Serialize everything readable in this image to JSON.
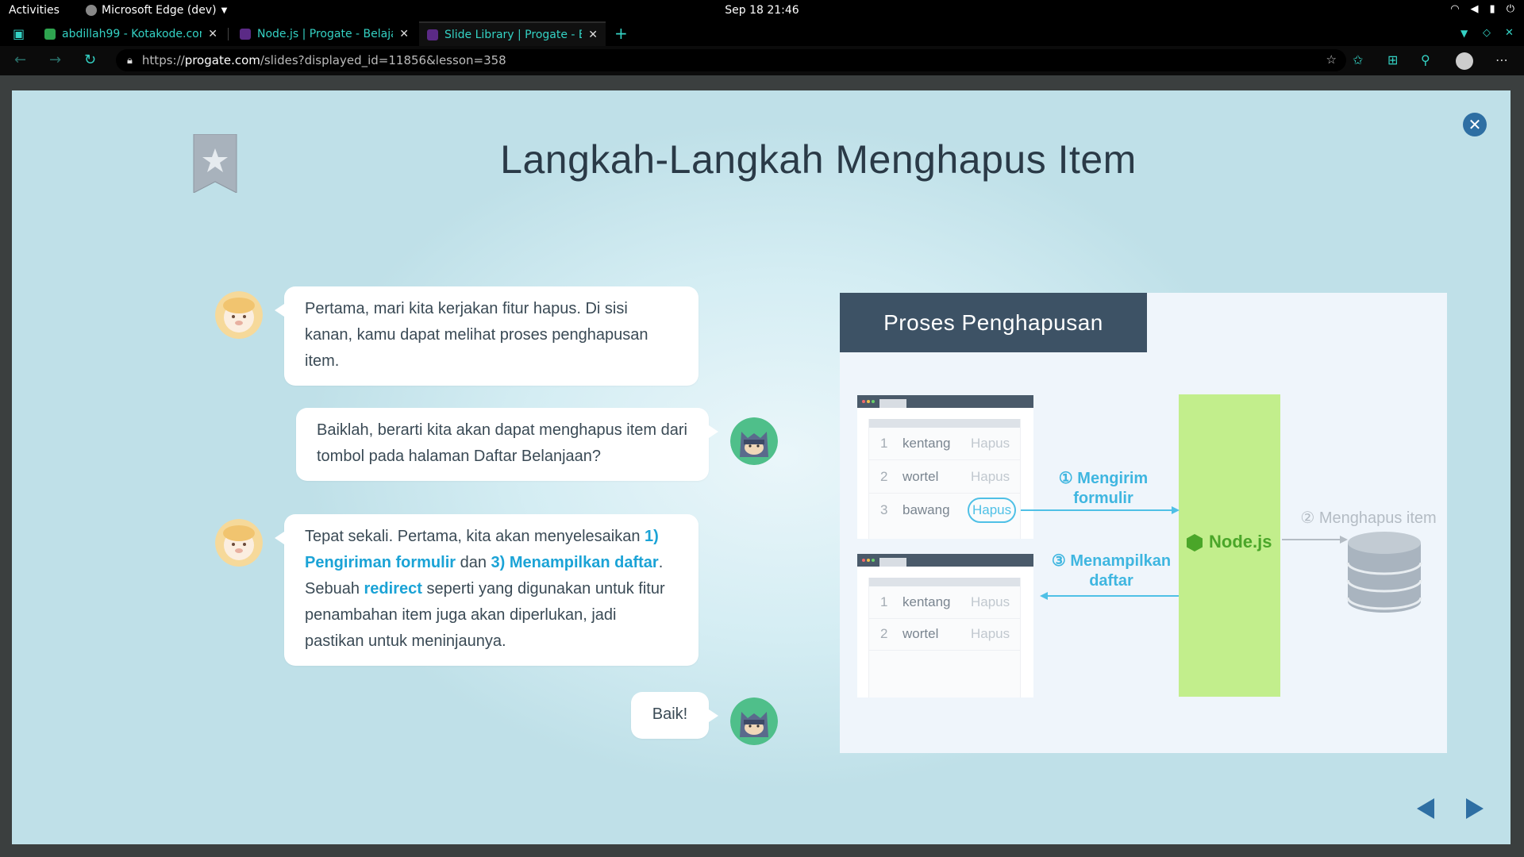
{
  "system": {
    "activities": "Activities",
    "app_name": "Microsoft Edge (dev)",
    "clock": "Sep 18  21:46"
  },
  "tabs": [
    {
      "title": "abdillah99 - Kotakode.com",
      "favicon_color": "#2ea44f"
    },
    {
      "title": "Node.js | Progate - Belajar",
      "favicon_color": "#5b2a86"
    },
    {
      "title": "Slide Library | Progate - Belajar",
      "favicon_color": "#5b2a86",
      "active": true
    }
  ],
  "address_bar": {
    "url_prefix": "https://",
    "url_domain": "progate.com",
    "url_path": "/slides?displayed_id=11856&lesson=358"
  },
  "slide": {
    "title": "Langkah-Langkah Menghapus Item",
    "messages": [
      {
        "speaker": "sheep",
        "text": "Pertama, mari kita kerjakan fitur hapus. Di sisi kanan, kamu dapat melihat proses penghapusan item."
      },
      {
        "speaker": "ninja",
        "text": "Baiklah, berarti kita akan dapat menghapus item dari tombol pada halaman Daftar Belanjaan?"
      },
      {
        "speaker": "sheep",
        "part1": "Tepat sekali. Pertama, kita akan menyelesaikan ",
        "hl1": "1) Pengiriman formulir",
        "part2": " dan ",
        "hl2": "3) Menampilkan daftar",
        "part3": ". Sebuah ",
        "hl3": "redirect",
        "part4": " seperti yang digunakan untuk fitur penambahan item juga akan diperlukan, jadi pastikan untuk meninjaunya."
      },
      {
        "speaker": "ninja",
        "text": "Baik!"
      }
    ],
    "diagram": {
      "title": "Proses Penghapusan",
      "list1": [
        {
          "no": "1",
          "item": "kentang",
          "action": "Hapus"
        },
        {
          "no": "2",
          "item": "wortel",
          "action": "Hapus"
        },
        {
          "no": "3",
          "item": "bawang",
          "action": "Hapus"
        }
      ],
      "list2": [
        {
          "no": "1",
          "item": "kentang",
          "action": "Hapus"
        },
        {
          "no": "2",
          "item": "wortel",
          "action": "Hapus"
        }
      ],
      "step1_num": "①",
      "step1_line1": "Mengirim",
      "step1_line2": "formulir",
      "step2_num": "②",
      "step2": "Menghapus item",
      "step3_num": "③",
      "step3_line1": "Menampilkan",
      "step3_line2": "daftar",
      "server": "Node.js"
    }
  },
  "colors": {
    "accent": "#1ba3d6",
    "nav_arrows": "#2e6fa3",
    "node_green": "#c2ee8c",
    "diagram_header": "#3d5265"
  }
}
